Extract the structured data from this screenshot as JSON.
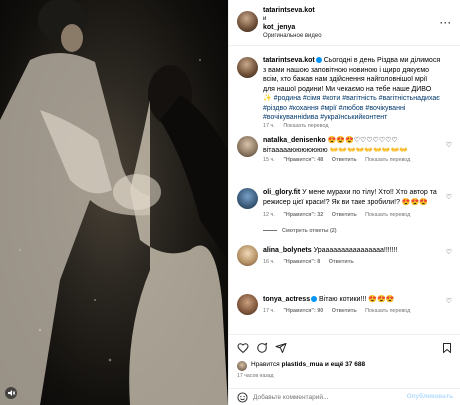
{
  "header": {
    "username": "tatarintseva.kot",
    "and_text": "и",
    "collab_username": "kot_jenya",
    "audio_label": "Оригинальное видео"
  },
  "caption": {
    "username": "tatarintseva.kot",
    "text": " Сьогодні в день Різдва ми ділимося з вами нашою заповітною новиною і щиро дякуємо всім, хто бажав нам здійснення найголовнішої мрії для нашої родини! Ми чекаємо на тебе наше ДИВО ",
    "tags": "#родина #сімя #коти #вагітність #вагітністьнадихає #різдво #кохання #мрії #любов #вочікуванні #вочікуванніdива #українськийконтент",
    "time": "17 ч.",
    "translate": "Показать перевод"
  },
  "comments": [
    {
      "username": "natalka_denisenko",
      "text": " 😍😍😍♡♡♡♡♡♡♡ вітаааааююююююю 👐👐👐👐👐👐👐👐👐",
      "time": "15 ч.",
      "likes": "\"Нравится\": 48",
      "reply": "Ответить",
      "translate": "Показать перевод"
    },
    {
      "username": "oli_glory.fit",
      "text": " У мене мурахи по тілу! Хто!! Хто автор та режисер цієї краси!? Як ви таке зробили!? 😍😍😍",
      "time": "12 ч.",
      "likes": "\"Нравится\": 32",
      "reply": "Ответить",
      "translate": "Показать перевод",
      "view_replies": "Смотреть ответы (2)"
    },
    {
      "username": "alina_bolynets",
      "text": " Ураааааааааааааааа!!!!!!!",
      "time": "16 ч.",
      "likes": "\"Нравится\": 8",
      "reply": "Ответить"
    },
    {
      "username": "tonya_actress",
      "text": " Вітаю котики!!! 😍😍😍",
      "time": "17 ч.",
      "likes": "\"Нравится\": 90",
      "reply": "Ответить",
      "translate": "Показать перевод"
    }
  ],
  "likes": {
    "prefix": "Нравится ",
    "user": "plastids_mua",
    "suffix": " и ещё 37 688"
  },
  "time_ago": "17 часов назад",
  "add_comment": {
    "placeholder": "Добавьте комментарий...",
    "post_label": "Опубликовать"
  },
  "icons": {
    "heart": "heart-icon",
    "comment": "comment-icon",
    "share": "share-icon",
    "save": "bookmark-icon",
    "emoji": "emoji-icon",
    "audio": "speaker-muted-icon"
  },
  "colors": {
    "link_blue": "#00376b",
    "verified_blue": "#0095f6",
    "muted_text": "#737373",
    "post_button": "#b3dbff"
  }
}
